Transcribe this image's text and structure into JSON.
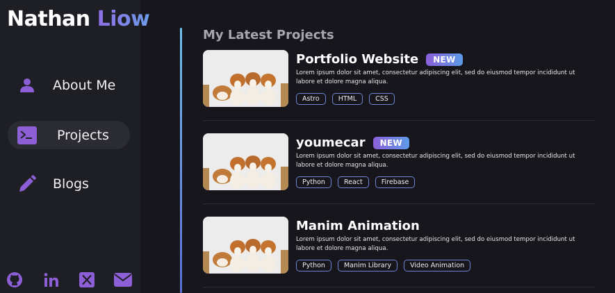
{
  "brand": {
    "first": "Nathan",
    "last": "Liow"
  },
  "nav": [
    {
      "label": "About Me",
      "icon": "person-icon",
      "active": false
    },
    {
      "label": "Projects",
      "icon": "terminal-icon",
      "active": true
    },
    {
      "label": "Blogs",
      "icon": "pencil-icon",
      "active": false
    }
  ],
  "socials": [
    "github-icon",
    "linkedin-icon",
    "x-twitter-icon",
    "mail-icon"
  ],
  "section_title": "My Latest Projects",
  "badge_label": "NEW",
  "projects": [
    {
      "title": "Portfolio Website",
      "is_new": true,
      "description": "Lorem ipsum dolor sit amet, consectetur adipiscing elit, sed do eiusmod tempor incididunt ut labore et dolore magna aliqua.",
      "tags": [
        "Astro",
        "HTML",
        "CSS"
      ]
    },
    {
      "title": "youmecar",
      "is_new": true,
      "description": "Lorem ipsum dolor sit amet, consectetur adipiscing elit, sed do eiusmod tempor incididunt ut labore et dolore magna aliqua.",
      "tags": [
        "Python",
        "React",
        "Firebase"
      ]
    },
    {
      "title": "Manim Animation",
      "is_new": false,
      "description": "Lorem ipsum dolor sit amet, consectetur adipiscing elit, sed do eiusmod tempor incididunt ut labore et dolore magna aliqua.",
      "tags": [
        "Python",
        "Manim Library",
        "Video Animation"
      ]
    }
  ],
  "colors": {
    "accent_purple": "#8d5fd6",
    "accent_blue": "#5d9be8",
    "sidebar_bg": "#1e1e25",
    "main_bg": "#16161c"
  }
}
